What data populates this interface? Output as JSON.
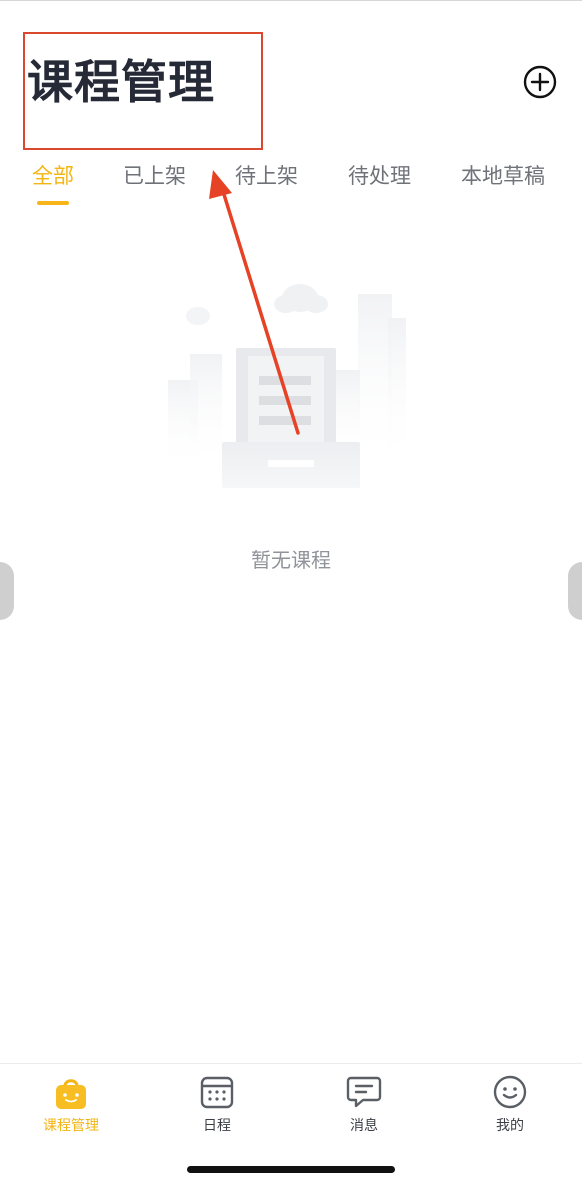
{
  "header": {
    "title": "课程管理"
  },
  "tabs": [
    {
      "label": "全部",
      "active": true
    },
    {
      "label": "已上架",
      "active": false
    },
    {
      "label": "待上架",
      "active": false
    },
    {
      "label": "待处理",
      "active": false
    },
    {
      "label": "本地草稿",
      "active": false
    }
  ],
  "empty_state": {
    "message": "暂无课程",
    "icon": "empty-document-icon"
  },
  "tabbar": {
    "items": [
      {
        "label": "课程管理",
        "icon": "bag-icon",
        "active": true
      },
      {
        "label": "日程",
        "icon": "calendar-icon",
        "active": false
      },
      {
        "label": "消息",
        "icon": "message-icon",
        "active": false
      },
      {
        "label": "我的",
        "icon": "smile-icon",
        "active": false
      }
    ]
  },
  "colors": {
    "accent": "#f4b411",
    "annotation": "#d9482f",
    "title": "#252a36",
    "tab_inactive": "#6f7379"
  }
}
